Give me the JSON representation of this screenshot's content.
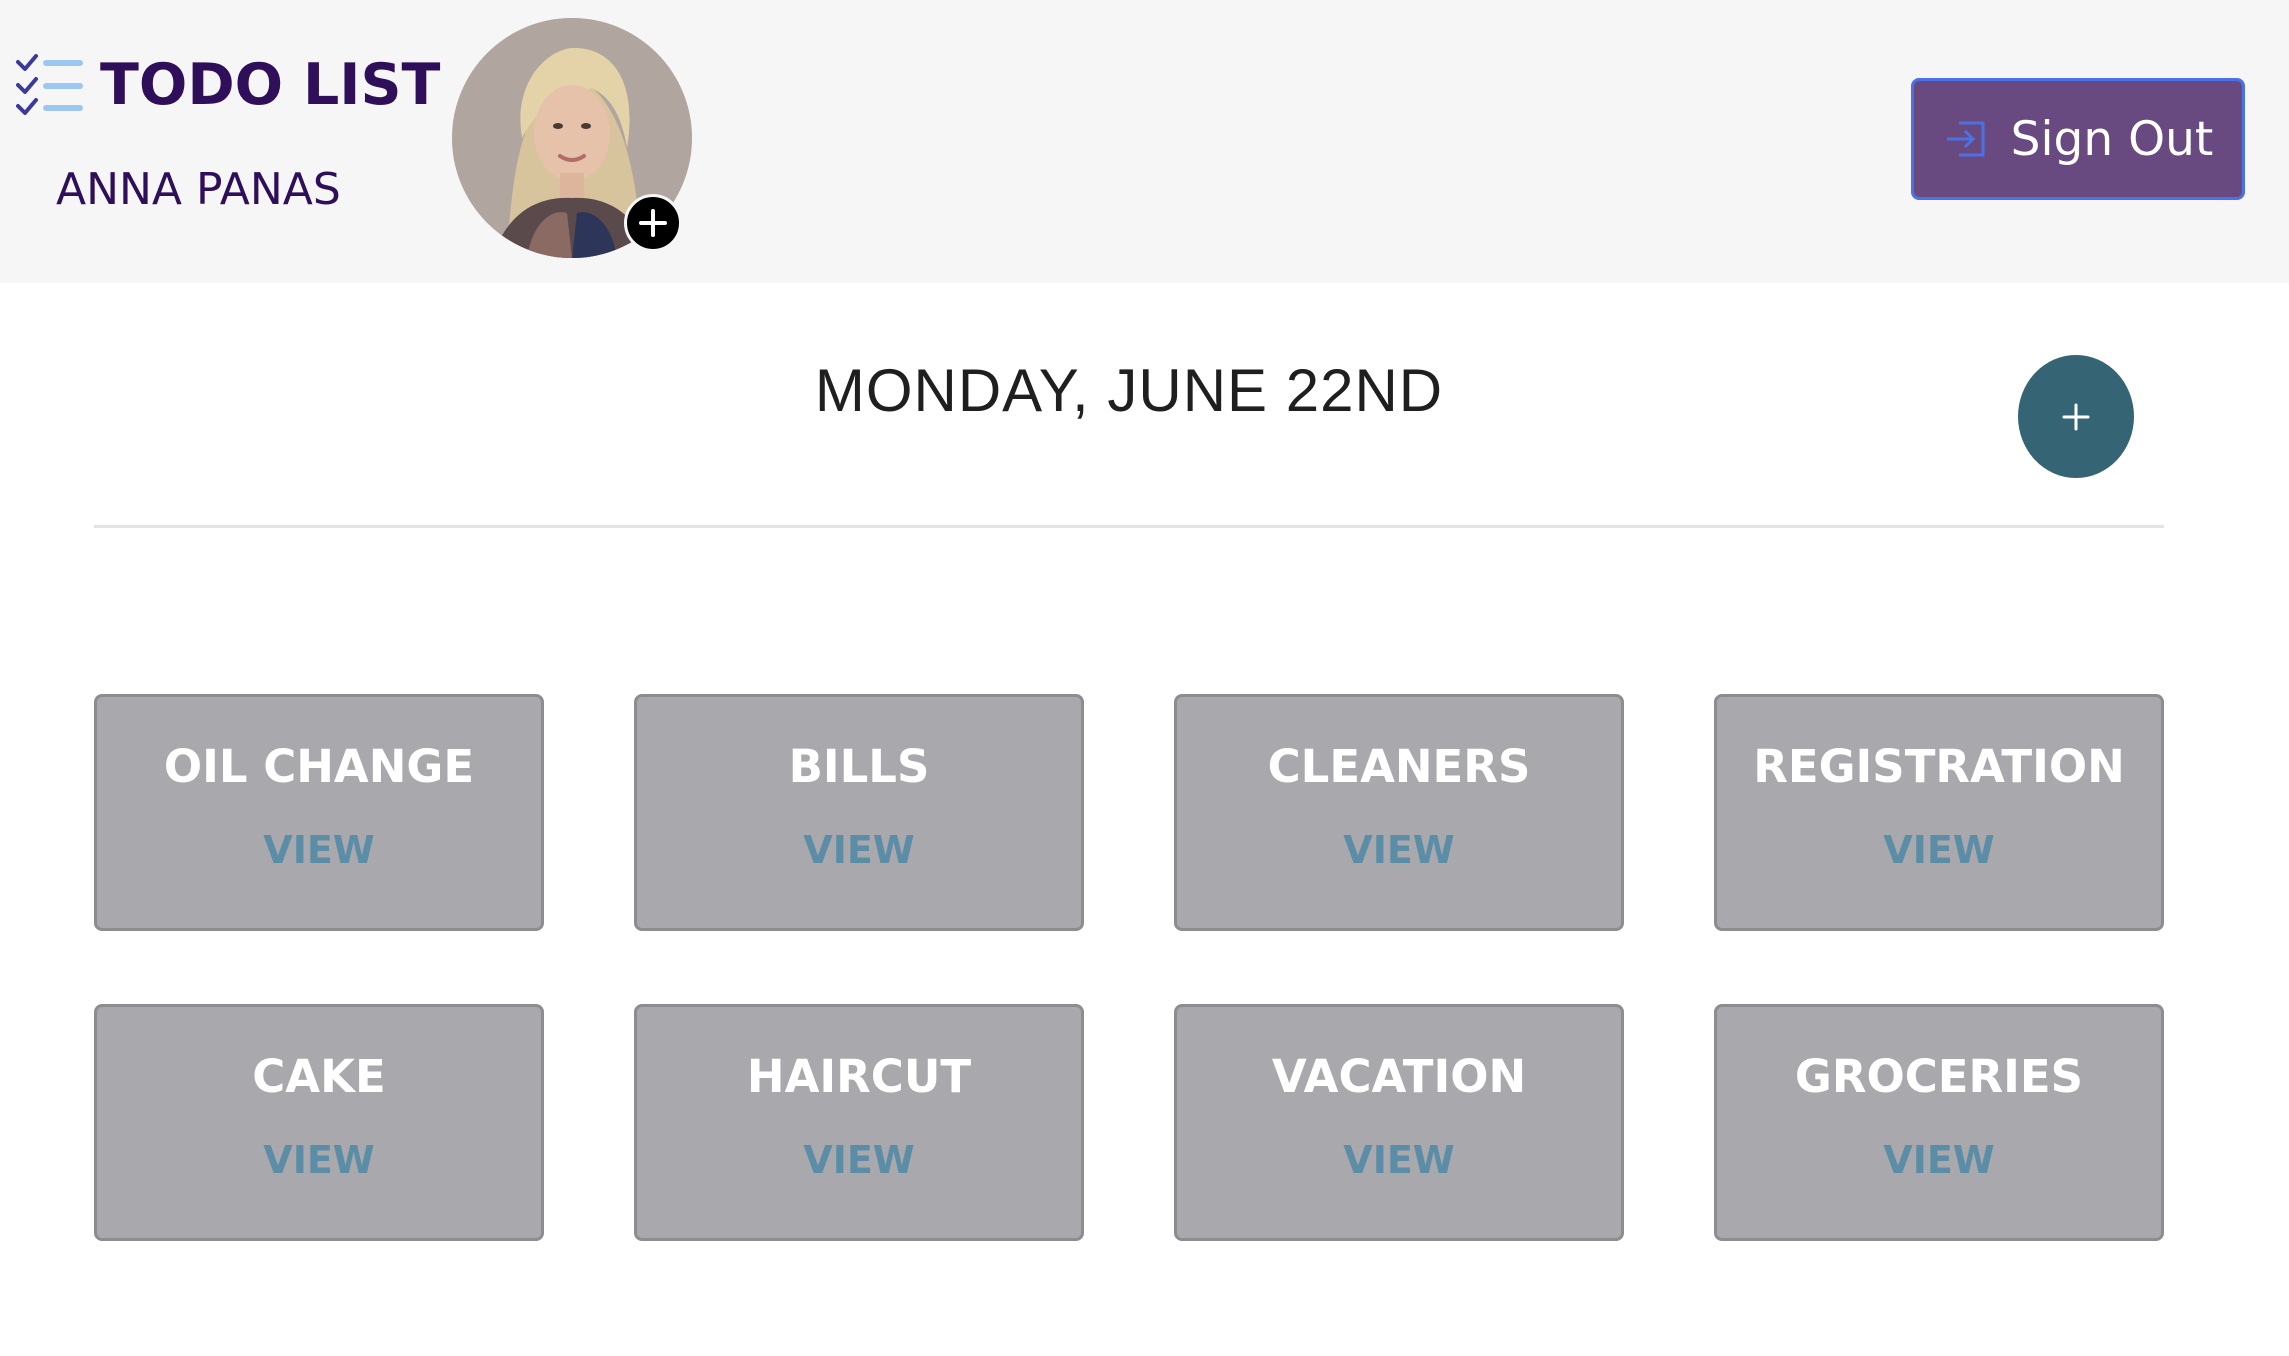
{
  "header": {
    "app_title": "TODO LIST",
    "user_name": "ANNA PANAS",
    "sign_out_label": "Sign Out",
    "icons": {
      "logo": "checklist-icon",
      "avatar_add": "plus-icon",
      "sign_out": "sign-in-arrow-icon"
    }
  },
  "main": {
    "date_title": "MONDAY, JUNE 22ND",
    "add_task_icon": "plus-icon",
    "tasks": [
      {
        "title": "OIL CHANGE",
        "action": "VIEW"
      },
      {
        "title": "BILLS",
        "action": "VIEW"
      },
      {
        "title": "CLEANERS",
        "action": "VIEW"
      },
      {
        "title": "REGISTRATION",
        "action": "VIEW"
      },
      {
        "title": "CAKE",
        "action": "VIEW"
      },
      {
        "title": "HAIRCUT",
        "action": "VIEW"
      },
      {
        "title": "VACATION",
        "action": "VIEW"
      },
      {
        "title": "GROCERIES",
        "action": "VIEW"
      }
    ]
  },
  "colors": {
    "brand_purple": "#2f0f5a",
    "sign_out_bg": "#684a80",
    "sign_out_border": "#4a72e6",
    "add_button": "#356475",
    "card_bg": "#a9a8ac",
    "view_link": "#5c8da7",
    "header_bg": "#f6f6f6"
  }
}
